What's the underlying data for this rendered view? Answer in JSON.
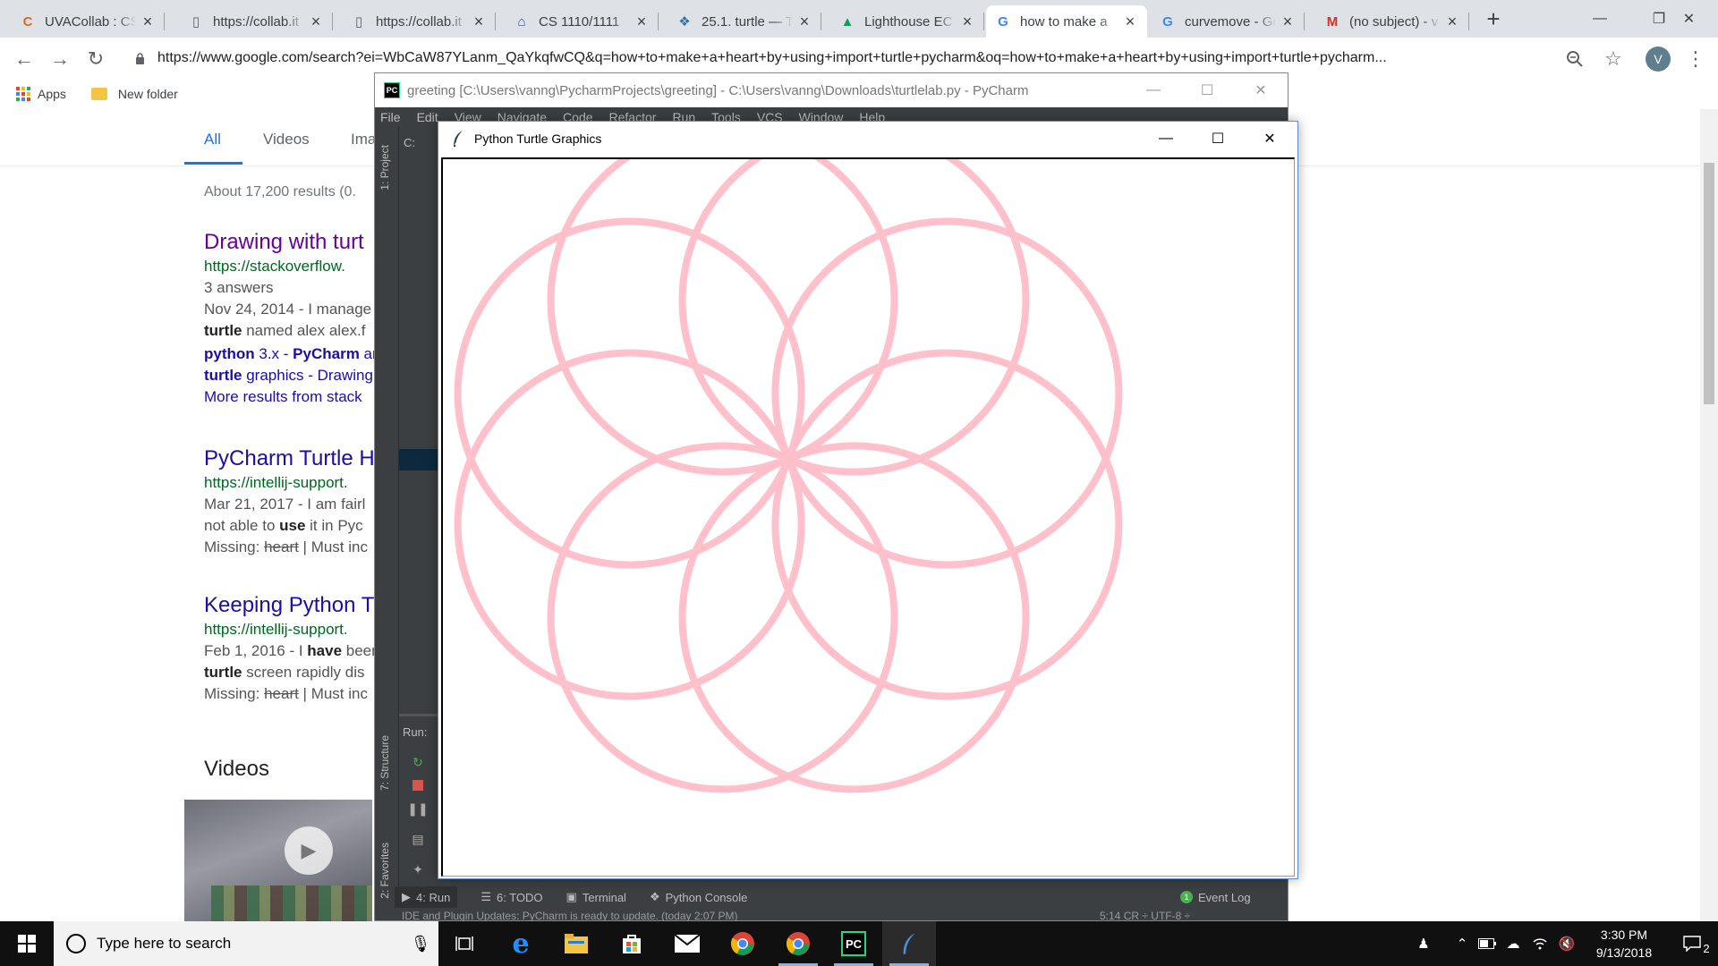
{
  "browser": {
    "tabs": [
      {
        "title": "UVACollab : CS",
        "icon": "collab-icon",
        "x": 0
      },
      {
        "title": "https://collab.it",
        "icon": "document-icon",
        "x": 0
      },
      {
        "title": "https://collab.it",
        "icon": "document-icon",
        "x": 0
      },
      {
        "title": "CS 1110/1111",
        "icon": "university-icon",
        "x": 0
      },
      {
        "title": "25.1. turtle — T",
        "icon": "python-icon",
        "x": 0
      },
      {
        "title": "Lighthouse EC",
        "icon": "lighthouse-icon",
        "x": 0
      },
      {
        "title": "how to make a",
        "icon": "google-icon",
        "x": 0
      },
      {
        "title": "curvemove - Go",
        "icon": "google-icon",
        "x": 0
      },
      {
        "title": "(no subject) - v",
        "icon": "gmail-icon",
        "x": 0
      }
    ],
    "active_tab_index": 6,
    "new_tab_label": "+",
    "url": "https://www.google.com/search?ei=WbCaW87YLanm_QaYkqfwCQ&q=how+to+make+a+heart+by+using+import+turtle+pycharm&oq=how+to+make+a+heart+by+using+import+turtle+pycharm...",
    "profile_initial": "V",
    "bookmarks": [
      {
        "label": "Apps",
        "icon": "apps-grid-icon"
      },
      {
        "label": "New folder",
        "icon": "folder-icon"
      }
    ]
  },
  "google": {
    "tabs": [
      "All",
      "Videos",
      "Ima"
    ],
    "stats": "About 17,200 results (0.",
    "results": [
      {
        "title": "Drawing with turt",
        "visited": true,
        "url": "https://stackoverflow.",
        "meta": "3 answers",
        "lines": [
          {
            "pre": "Nov 24, 2014 - I manage",
            "b": "",
            "post": ""
          },
          {
            "pre": "",
            "b": "turtle",
            "post": " named alex alex.f"
          }
        ],
        "sublinks": [
          {
            "b1": "python",
            "m": " 3.x - ",
            "b2": "PyCharm",
            "e": " ar"
          },
          {
            "b1": "turtle",
            "m": " graphics - Drawing",
            "b2": "",
            "e": ""
          }
        ],
        "more": "More results from stack"
      },
      {
        "title": "PyCharm Turtle H",
        "url": "https://intellij-support.",
        "lines": [
          {
            "pre": "Mar 21, 2017 - I am fairl",
            "b": "",
            "post": ""
          },
          {
            "pre": "not able to ",
            "b": "use",
            "post": " it in Pyc"
          }
        ],
        "missing_label": "Missing: ",
        "missing_word": "heart",
        "missing_tail": " | Must inc"
      },
      {
        "title": "Keeping Python T",
        "url": "https://intellij-support.",
        "lines": [
          {
            "pre": "Feb 1, 2016 - I ",
            "b": "have",
            "post": " been"
          },
          {
            "pre": "",
            "b": "turtle",
            "post": " screen rapidly dis"
          }
        ],
        "missing_label": "Missing: ",
        "missing_word": "heart",
        "missing_tail": " | Must inc"
      }
    ],
    "videos_heading": "Videos"
  },
  "pycharm": {
    "logo": "PC",
    "title": "greeting [C:\\Users\\vanng\\PycharmProjects\\greeting] - C:\\Users\\vanng\\Downloads\\turtlelab.py - PyCharm",
    "menu": [
      "File",
      "Edit",
      "View",
      "Navigate",
      "Code",
      "Refactor",
      "Run",
      "Tools",
      "VCS",
      "Window",
      "Help"
    ],
    "breadcrumb": "C:",
    "side_tabs": {
      "project": "1: Project",
      "structure": "7: Structure",
      "favorites": "2: Favorites"
    },
    "run_label": "Run:",
    "bottom_tabs": [
      {
        "label": "4: Run",
        "icon": "run-icon"
      },
      {
        "label": "6: TODO",
        "icon": "todo-icon"
      },
      {
        "label": "Terminal",
        "icon": "terminal-icon"
      },
      {
        "label": "Python Console",
        "icon": "python-console-icon"
      }
    ],
    "event_log": "Event Log",
    "event_count": "1",
    "status": "IDE and Plugin Updates: PyCharm is ready to update. (today 2:07 PM)",
    "status_right": "5:14   CR ÷   UTF-8 ÷"
  },
  "turtle": {
    "title": "Python Turtle Graphics",
    "pen_color": "#ffc0cb",
    "petals": 8,
    "radius_px": 192
  },
  "taskbar": {
    "search_placeholder": "Type here to search",
    "time": "3:30 PM",
    "date": "9/13/2018",
    "notification_count": "2"
  }
}
